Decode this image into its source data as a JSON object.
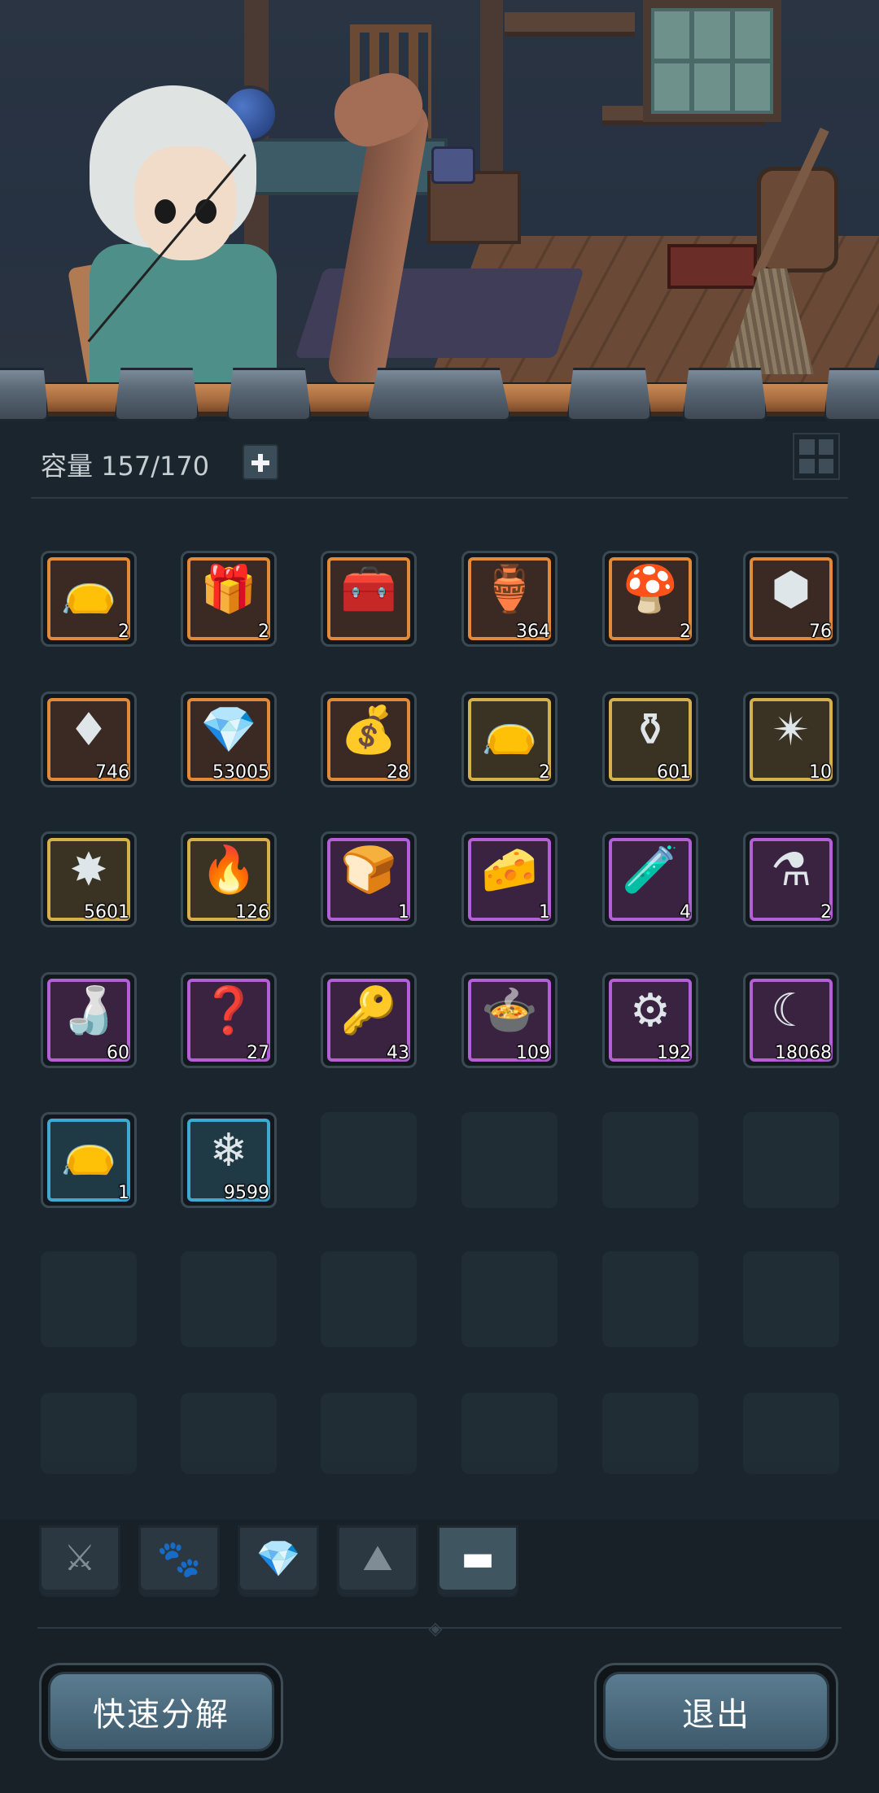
{
  "inventory": {
    "capacity_label": "容量",
    "capacity_value": "157/170",
    "items": [
      {
        "name": "treasure-bag",
        "glyph": "👝",
        "qty": "2",
        "rarity": "orange"
      },
      {
        "name": "mystery-gift-bag",
        "glyph": "🎁",
        "qty": "2",
        "rarity": "orange"
      },
      {
        "name": "teal-chest",
        "glyph": "🧰",
        "qty": "",
        "rarity": "orange"
      },
      {
        "name": "golden-vase",
        "glyph": "🏺",
        "qty": "364",
        "rarity": "orange"
      },
      {
        "name": "mushroom",
        "glyph": "🍄",
        "qty": "2",
        "rarity": "orange"
      },
      {
        "name": "purple-rune-stone",
        "glyph": "⬢",
        "qty": "76",
        "rarity": "orange"
      },
      {
        "name": "red-crystal",
        "glyph": "♦",
        "qty": "746",
        "rarity": "orange"
      },
      {
        "name": "purple-crystal",
        "glyph": "💎",
        "qty": "53005",
        "rarity": "orange"
      },
      {
        "name": "green-pouch",
        "glyph": "💰",
        "qty": "28",
        "rarity": "orange"
      },
      {
        "name": "treasure-bag-gold",
        "glyph": "👝",
        "qty": "2",
        "rarity": "gold"
      },
      {
        "name": "blue-jar",
        "glyph": "⚱",
        "qty": "601",
        "rarity": "gold"
      },
      {
        "name": "star-shard",
        "glyph": "✴",
        "qty": "10",
        "rarity": "gold"
      },
      {
        "name": "fire-crystal",
        "glyph": "✸",
        "qty": "5601",
        "rarity": "gold"
      },
      {
        "name": "flame-egg",
        "glyph": "🔥",
        "qty": "126",
        "rarity": "gold"
      },
      {
        "name": "bread",
        "glyph": "🍞",
        "qty": "1",
        "rarity": "purple"
      },
      {
        "name": "cheese",
        "glyph": "🧀",
        "qty": "1",
        "rarity": "purple"
      },
      {
        "name": "paw-potion",
        "glyph": "🧪",
        "qty": "4",
        "rarity": "purple"
      },
      {
        "name": "round-potion",
        "glyph": "⚗",
        "qty": "2",
        "rarity": "purple"
      },
      {
        "name": "elixir-bottle",
        "glyph": "🍶",
        "qty": "60",
        "rarity": "purple"
      },
      {
        "name": "mystery-chest",
        "glyph": "❓",
        "qty": "27",
        "rarity": "purple"
      },
      {
        "name": "golden-key",
        "glyph": "🔑",
        "qty": "43",
        "rarity": "purple"
      },
      {
        "name": "cauldron",
        "glyph": "🍲",
        "qty": "109",
        "rarity": "purple"
      },
      {
        "name": "blue-ring",
        "glyph": "⚙",
        "qty": "192",
        "rarity": "purple"
      },
      {
        "name": "purple-claw",
        "glyph": "☾",
        "qty": "18068",
        "rarity": "purple"
      },
      {
        "name": "blue-treasure-bag",
        "glyph": "👝",
        "qty": "1",
        "rarity": "blue"
      },
      {
        "name": "ice-crystal",
        "glyph": "❄",
        "qty": "9599",
        "rarity": "blue"
      }
    ],
    "empty_slots": 16
  },
  "tabs": [
    {
      "name": "tab-weapons",
      "icon": "sword-icon",
      "glyph": "⚔",
      "active": false
    },
    {
      "name": "tab-pets",
      "icon": "paw-icon",
      "glyph": "🐾",
      "active": false
    },
    {
      "name": "tab-gems",
      "icon": "gem-icon",
      "glyph": "💎",
      "active": false
    },
    {
      "name": "tab-materials",
      "icon": "stone-icon",
      "glyph": "⛰",
      "active": false
    },
    {
      "name": "tab-chests",
      "icon": "chest-icon",
      "glyph": "▬",
      "active": true
    }
  ],
  "footer": {
    "quick_decompose_label": "快速分解",
    "exit_label": "退出"
  },
  "colors": {
    "orange": "#e08a3a",
    "gold": "#d6b04a",
    "purple": "#b35fd6",
    "blue": "#3fa9d1",
    "button": "#4a697c"
  }
}
